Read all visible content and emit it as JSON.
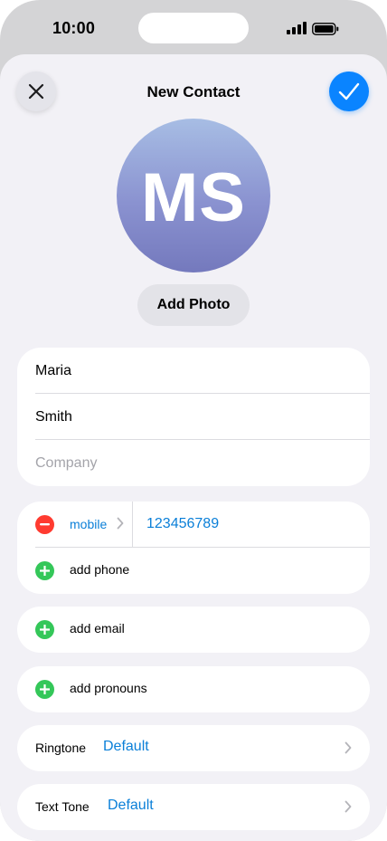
{
  "status_bar": {
    "time": "10:00"
  },
  "nav": {
    "title": "New Contact"
  },
  "avatar": {
    "initials": "MS"
  },
  "add_photo_label": "Add Photo",
  "name_fields": {
    "first_name": "Maria",
    "last_name": "Smith",
    "company_placeholder": "Company"
  },
  "phone": {
    "label": "mobile",
    "number": "123456789",
    "add_label": "add phone"
  },
  "email": {
    "add_label": "add email"
  },
  "pronouns": {
    "add_label": "add pronouns"
  },
  "ringtone": {
    "label": "Ringtone",
    "value": "Default"
  },
  "text_tone": {
    "label": "Text Tone",
    "value": "Default"
  },
  "colors": {
    "accent": "#0a84ff",
    "link": "#0a7fd8",
    "delete": "#ff3b30",
    "add": "#34c759",
    "background": "#f2f1f6"
  }
}
